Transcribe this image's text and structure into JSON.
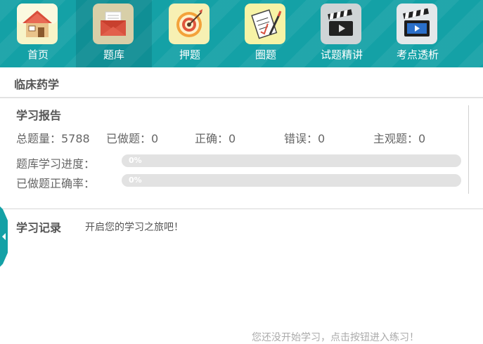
{
  "nav": {
    "items": [
      {
        "label": "首页",
        "icon": "home-icon"
      },
      {
        "label": "题库",
        "icon": "envelope-icon"
      },
      {
        "label": "押题",
        "icon": "target-icon"
      },
      {
        "label": "圈题",
        "icon": "notepad-pen-icon"
      },
      {
        "label": "试题精讲",
        "icon": "clapperboard-icon"
      },
      {
        "label": "考点透析",
        "icon": "video-clapper-icon"
      }
    ],
    "active_index": 1
  },
  "subject": {
    "title": "临床药学"
  },
  "report": {
    "title": "学习报告",
    "stats": {
      "total": "总题量：5788",
      "done": "已做题：0",
      "correct": "正确：0",
      "wrong": "错误：0",
      "subjective": "主观题：0"
    },
    "progress": {
      "label": "题库学习进度：",
      "percent_text": "0%",
      "value": 0
    },
    "accuracy": {
      "label": "已做题正确率：",
      "percent_text": "0%",
      "value": 0
    }
  },
  "records": {
    "title": "学习记录",
    "intro": "开启您的学习之旅吧！",
    "empty_text": "您还没开始学习，点击按钮进入练习！"
  },
  "colors": {
    "accent": "#14a1a6",
    "track": "#e2e2e2"
  }
}
